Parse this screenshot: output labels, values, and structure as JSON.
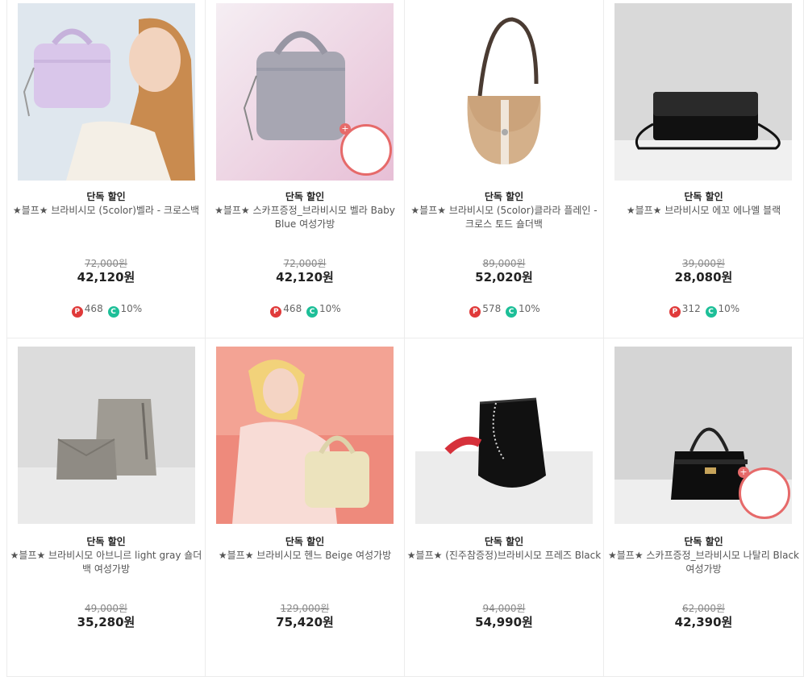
{
  "products": [
    {
      "tag": "단독 할인",
      "name": "★블프★ 브라비시모 (5color)벨라 - 크로스백",
      "original_price": "72,000원",
      "price": "42,120원",
      "points": "468",
      "coupon": "10%",
      "image": "lavender-bag-model",
      "has_gift": false
    },
    {
      "tag": "단독 할인",
      "name": "★블프★ 스카프증정_브라비시모 벨라 Baby Blue 여성가방",
      "original_price": "72,000원",
      "price": "42,120원",
      "points": "468",
      "coupon": "10%",
      "image": "gray-bag-scarf",
      "has_gift": true
    },
    {
      "tag": "단독 할인",
      "name": "★블프★ 브라비시모 (5color)클라라 플레인 - 크로스 토드 숄더백",
      "original_price": "89,000원",
      "price": "52,020원",
      "points": "578",
      "coupon": "10%",
      "image": "beige-saddle-bag",
      "has_gift": false
    },
    {
      "tag": "단독 할인",
      "name": "★블프★ 브라비시모 에꼬 에나멜 블랙",
      "original_price": "39,000원",
      "price": "28,080원",
      "points": "312",
      "coupon": "10%",
      "image": "black-enamel-clutch",
      "has_gift": false
    },
    {
      "tag": "단독 할인",
      "name": "★블프★ 브라비시모 아브니르 light gray 숄더백 여성가방",
      "original_price": "49,000원",
      "price": "35,280원",
      "points": "",
      "coupon": "",
      "image": "gray-tote-set",
      "has_gift": false
    },
    {
      "tag": "단독 할인",
      "name": "★블프★ 브라비시모 헨느 Beige 여성가방",
      "original_price": "129,000원",
      "price": "75,420원",
      "points": "",
      "coupon": "",
      "image": "beige-bag-model",
      "has_gift": false
    },
    {
      "tag": "단독 할인",
      "name": "★블프★ (진주참증정)브라비시모 프레즈 Black",
      "original_price": "94,000원",
      "price": "54,990원",
      "points": "",
      "coupon": "",
      "image": "black-bucket-bag",
      "has_gift": false
    },
    {
      "tag": "단독 할인",
      "name": "★블프★ 스카프증정_브라비시모 나탈리 Black 여성가방",
      "original_price": "62,000원",
      "price": "42,390원",
      "points": "",
      "coupon": "",
      "image": "black-top-handle-bag",
      "has_gift": true
    }
  ],
  "badges": {
    "points_letter": "P",
    "coupon_letter": "C"
  },
  "colors": {
    "points": "#e03a3a",
    "coupon": "#1dbf98",
    "gift_border": "#e66a6a"
  }
}
